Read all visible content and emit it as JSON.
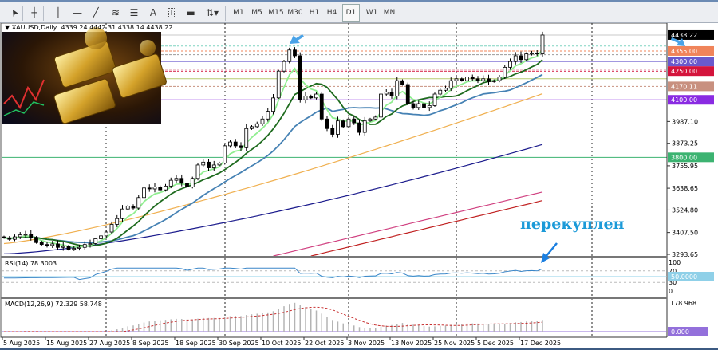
{
  "toolbar": {
    "tools": [
      "cursor-icon",
      "crosshair-icon",
      "vertical-line-icon",
      "horizontal-line-icon",
      "trendline-icon",
      "fibo-channel-icon",
      "fibo-retracement-icon",
      "text-icon",
      "text-label-icon",
      "rectangle-icon",
      "arrows-dropdown-icon"
    ],
    "text_tool_label": "A",
    "label_tool_label": "T",
    "timeframes": [
      "M1",
      "M5",
      "M15",
      "M30",
      "H1",
      "H4",
      "D1",
      "W1",
      "MN"
    ],
    "active_timeframe": "D1"
  },
  "chart": {
    "symbol": "XAUUSD,Daily",
    "ohlc": "4339.24 4442.31 4338.14 4438.22",
    "annotation": "перекуплен",
    "annotation_color": "#1b9ad8"
  },
  "chart_data": {
    "type": "candlestick",
    "closes": [
      3380,
      3372,
      3385,
      3395,
      3398,
      3382,
      3355,
      3345,
      3340,
      3348,
      3330,
      3335,
      3320,
      3325,
      3330,
      3345,
      3350,
      3375,
      3390,
      3410,
      3450,
      3480,
      3530,
      3545,
      3535,
      3590,
      3640,
      3635,
      3645,
      3630,
      3650,
      3680,
      3690,
      3665,
      3645,
      3690,
      3760,
      3775,
      3745,
      3760,
      3770,
      3860,
      3880,
      3860,
      3850,
      3950,
      3960,
      3975,
      4000,
      4040,
      4110,
      4250,
      4300,
      4360,
      4330,
      4100,
      4120,
      4110,
      4130,
      4000,
      3950,
      3920,
      3990,
      3960,
      4000,
      3980,
      3930,
      3990,
      4000,
      4010,
      4130,
      4140,
      4120,
      4200,
      4180,
      4080,
      4060,
      4080,
      4060,
      4070,
      4130,
      4150,
      4160,
      4200,
      4210,
      4200,
      4220,
      4210,
      4200,
      4210,
      4195,
      4200,
      4220,
      4270,
      4300,
      4330,
      4310,
      4340,
      4345,
      4340,
      4438.22
    ],
    "x_labels": [
      "5 Aug 2025",
      "15 Aug 2025",
      "27 Aug 2025",
      "8 Sep 2025",
      "18 Sep 2025",
      "30 Sep 2025",
      "10 Oct 2025",
      "22 Oct 2025",
      "3 Nov 2025",
      "13 Nov 2025",
      "25 Nov 2025",
      "5 Dec 2025",
      "17 Dec 2025"
    ],
    "price_ticks": [
      "3987.10",
      "3873.25",
      "3755.95",
      "3638.65",
      "3524.80",
      "3407.50",
      "3293.65"
    ],
    "current_price": {
      "label": "4438.22",
      "color": "#000000"
    },
    "levels": [
      {
        "price": 4380.58,
        "color": "#7fd3c0",
        "style": "dotted"
      },
      {
        "price": 4355.0,
        "label": "4355.00",
        "color": "#f0845a",
        "style": "dotted"
      },
      {
        "price": 4335.55,
        "color": "#999999",
        "style": "dotted"
      },
      {
        "price": 4300.0,
        "label": "4300.00",
        "color": "#6a5acd",
        "style": "solid"
      },
      {
        "price": 4260.0,
        "color": "#c0304a",
        "style": "dotted"
      },
      {
        "price": 4250.0,
        "label": "4250.00",
        "color": "#d4143c",
        "style": "dotted"
      },
      {
        "price": 4210.25,
        "color": "#b8cc70",
        "style": "solid"
      },
      {
        "price": 4170.11,
        "label": "4170.11",
        "color": "#c8907f",
        "style": "dotted"
      },
      {
        "price": 4100.0,
        "label": "4100.00",
        "color": "#8a2be2",
        "style": "solid"
      },
      {
        "price": 3800.0,
        "label": "3800.00",
        "color": "#3cb371",
        "style": "solid"
      }
    ],
    "rsi": {
      "title": "RSI(14) 78.3003",
      "levels": [
        "100",
        "70",
        "30",
        "0"
      ],
      "mid_label": "50.0000",
      "color": "#3a86c8"
    },
    "macd": {
      "title": "MACD(12,26,9) 72.329 58.748",
      "max_label": "178.968",
      "zero_label": "0.000",
      "histogram_color": "#b4b4b4",
      "signal_color": "#c83232"
    },
    "ma_colors": [
      "#90ee90",
      "#1e6b1e",
      "#4682b4",
      "#f0b050",
      "#1a1a8c",
      "#d04080",
      "#c02020"
    ]
  }
}
